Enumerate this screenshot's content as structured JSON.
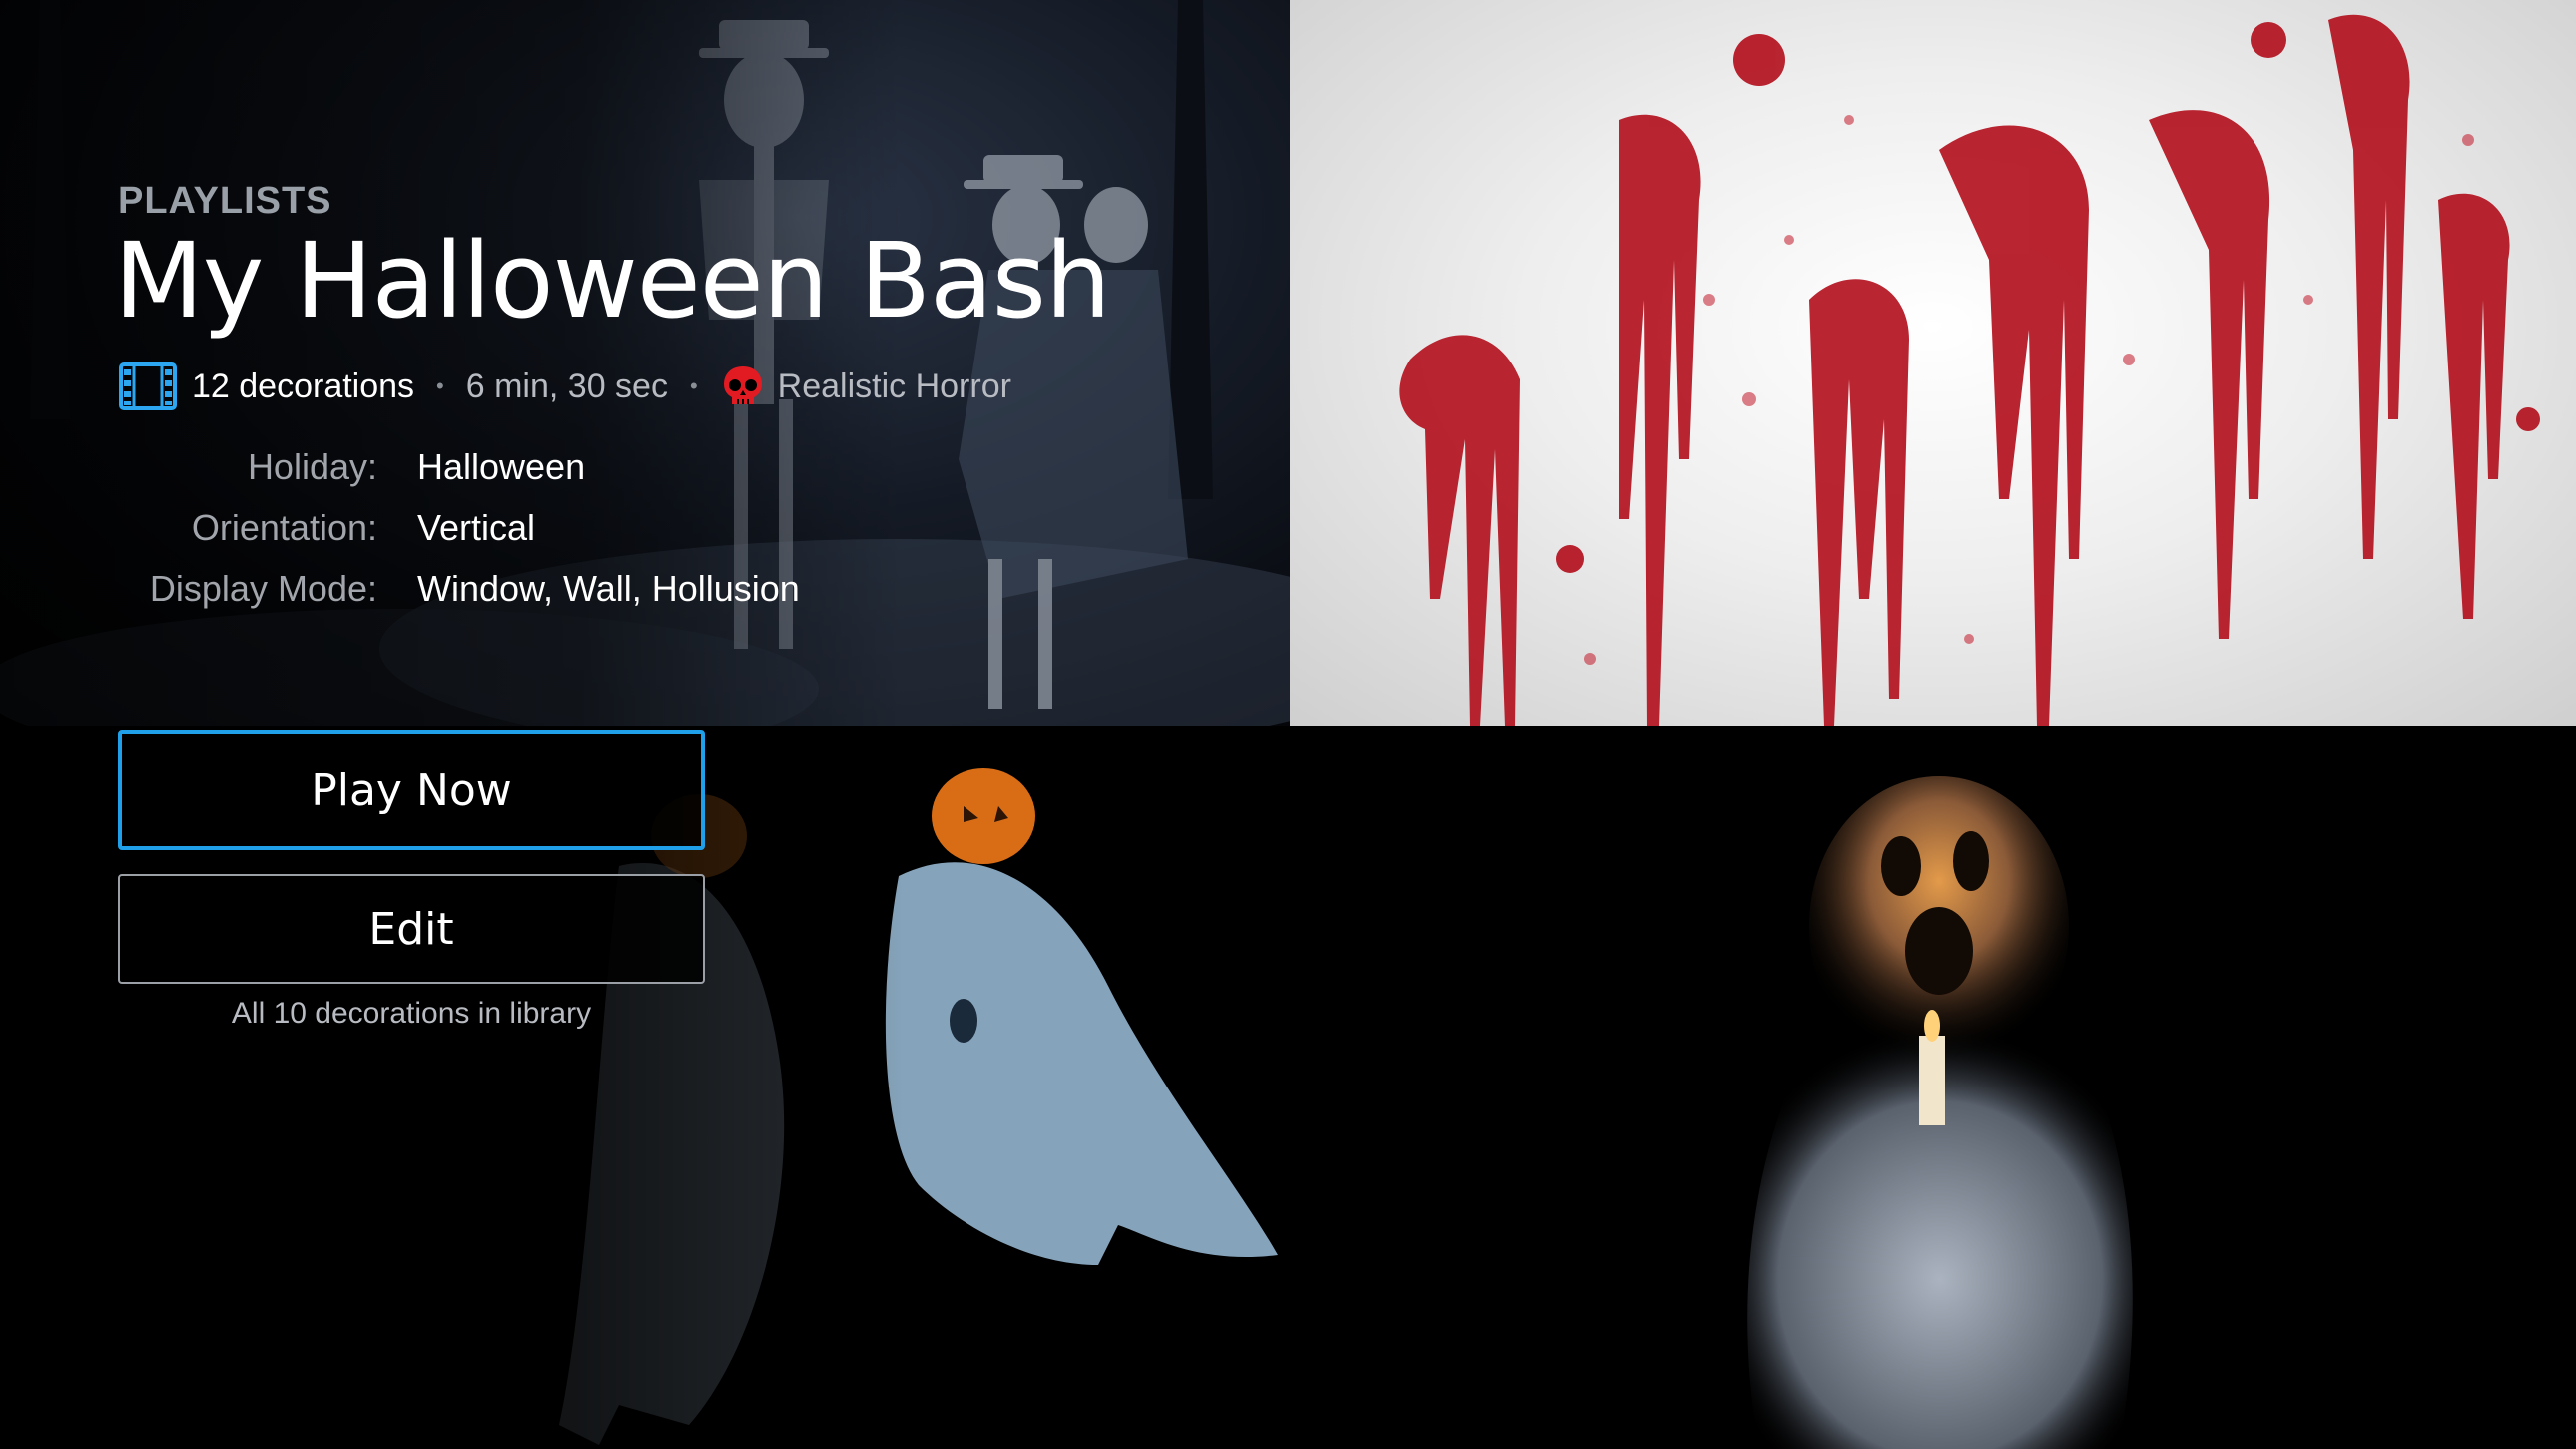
{
  "header": {
    "section_label": "PLAYLISTS",
    "title": "My Halloween Bash"
  },
  "meta": {
    "decorations_count": "12 decorations",
    "duration": "6 min, 30 sec",
    "category": "Realistic Horror",
    "separator": "•",
    "icons": {
      "count_icon": "film-strip-icon",
      "category_icon": "skull-icon"
    },
    "colors": {
      "film_icon": "#2ca6f0",
      "skull_icon": "#e21b23"
    }
  },
  "details": [
    {
      "label": "Holiday:",
      "value": "Halloween"
    },
    {
      "label": "Orientation:",
      "value": "Vertical"
    },
    {
      "label": "Display Mode:",
      "value": "Window, Wall, Hollusion"
    }
  ],
  "actions": {
    "play_label": "Play Now",
    "edit_label": "Edit",
    "library_note": "All 10 decorations in library"
  },
  "colors": {
    "accent_focus": "#1fa0e8",
    "background": "#000000",
    "muted_text": "#9aa0a8"
  },
  "thumbnails": [
    "dancing-skeletons",
    "blood-splatter",
    "ghosts-with-pumpkins",
    "candle-ghost"
  ]
}
